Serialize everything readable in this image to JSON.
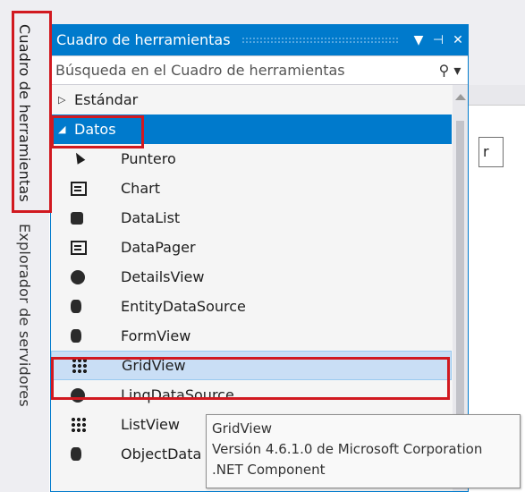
{
  "side_tabs": {
    "toolbox": "Cuadro de herramientas",
    "server_explorer": "Explorador de servidores"
  },
  "panel": {
    "title": "Cuadro de herramientas",
    "search_placeholder": "Búsqueda en el Cuadro de herramientas",
    "title_icons": [
      "dropdown-icon",
      "pin-icon",
      "close-icon"
    ]
  },
  "groups": [
    {
      "label": "Estándar",
      "expanded": false
    },
    {
      "label": "Datos",
      "expanded": true
    }
  ],
  "items": [
    {
      "label": "Puntero",
      "icon": "pointer-icon"
    },
    {
      "label": "Chart",
      "icon": "chart-icon"
    },
    {
      "label": "DataList",
      "icon": "datalist-icon"
    },
    {
      "label": "DataPager",
      "icon": "datapager-icon"
    },
    {
      "label": "DetailsView",
      "icon": "detailsview-icon"
    },
    {
      "label": "EntityDataSource",
      "icon": "entitydatasource-icon"
    },
    {
      "label": "FormView",
      "icon": "formview-icon"
    },
    {
      "label": "GridView",
      "icon": "gridview-icon"
    },
    {
      "label": "LinqDataSource",
      "icon": "linqdatasource-icon"
    },
    {
      "label": "ListView",
      "icon": "listview-icon"
    },
    {
      "label": "ObjectData",
      "icon": "objectdatasource-icon"
    }
  ],
  "tooltip": {
    "name": "GridView",
    "version": "Versión 4.6.1.0 de Microsoft Corporation",
    "type": ".NET Component"
  },
  "editor": {
    "button_char": "r"
  },
  "colors": {
    "accent": "#007acc",
    "highlight": "#d11920",
    "hover": "#c9def5"
  }
}
